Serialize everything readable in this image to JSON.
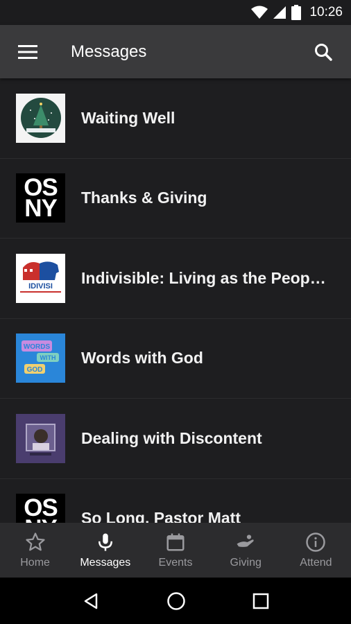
{
  "status_bar": {
    "time": "10:26",
    "icons": [
      "wifi-icon",
      "cell-signal-icon",
      "battery-icon"
    ]
  },
  "app_bar": {
    "title": "Messages",
    "menu_icon": "hamburger-menu-icon",
    "search_icon": "search-icon"
  },
  "messages": [
    {
      "title": "Waiting Well"
    },
    {
      "title": "Thanks & Giving",
      "thumb_text": [
        "OS",
        "NY"
      ]
    },
    {
      "title": "Indivisible: Living as the People…",
      "thumb_text": "IDIVISI"
    },
    {
      "title": "Words with God",
      "thumb_text": [
        "WORDS",
        "WITH",
        "GOD"
      ]
    },
    {
      "title": "Dealing with Discontent"
    },
    {
      "title": "So Long, Pastor Matt",
      "thumb_text": [
        "OS",
        "NY"
      ]
    }
  ],
  "bottom_nav": [
    {
      "label": "Home",
      "icon": "star-icon",
      "active": false
    },
    {
      "label": "Messages",
      "icon": "microphone-icon",
      "active": true
    },
    {
      "label": "Events",
      "icon": "calendar-icon",
      "active": false
    },
    {
      "label": "Giving",
      "icon": "giving-hand-icon",
      "active": false
    },
    {
      "label": "Attend",
      "icon": "info-icon",
      "active": false
    }
  ],
  "system_nav": [
    "back-icon",
    "home-icon",
    "recents-icon"
  ],
  "colors": {
    "background": "#1e1e20",
    "app_bar": "#3a3a3c",
    "bottom_nav": "#2c2c2e",
    "inactive": "#9a9a9e",
    "active": "#ffffff"
  }
}
